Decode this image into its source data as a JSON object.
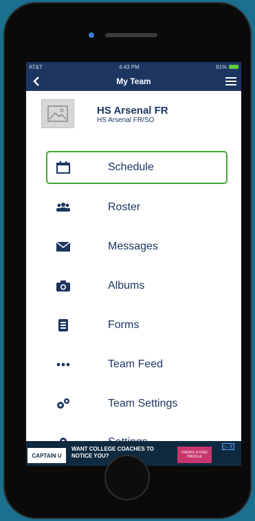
{
  "status_bar": {
    "carrier": "AT&T",
    "time": "4:43 PM",
    "battery": "81%"
  },
  "nav": {
    "title": "My Team"
  },
  "team": {
    "name": "HS Arsenal FR",
    "subtitle": "HS Arsenal FR/SO"
  },
  "menu": {
    "items": [
      {
        "label": "Schedule",
        "icon": "calendar-icon",
        "selected": true
      },
      {
        "label": "Roster",
        "icon": "people-icon"
      },
      {
        "label": "Messages",
        "icon": "envelope-icon"
      },
      {
        "label": "Albums",
        "icon": "camera-icon"
      },
      {
        "label": "Forms",
        "icon": "document-icon"
      },
      {
        "label": "Team Feed",
        "icon": "dots-icon"
      },
      {
        "label": "Team Settings",
        "icon": "gears-icon"
      },
      {
        "label": "Settings",
        "icon": "gear-icon"
      }
    ]
  },
  "ad": {
    "logo": "CAPTAIN U",
    "headline": "WANT COLLEGE COACHES TO NOTICE YOU?",
    "cta": "CREATE A FREE PROFILE",
    "close": "▷ X"
  },
  "colors": {
    "nav_bg": "#1c3561",
    "text": "#1c3561",
    "selected_border": "#3fa535"
  }
}
